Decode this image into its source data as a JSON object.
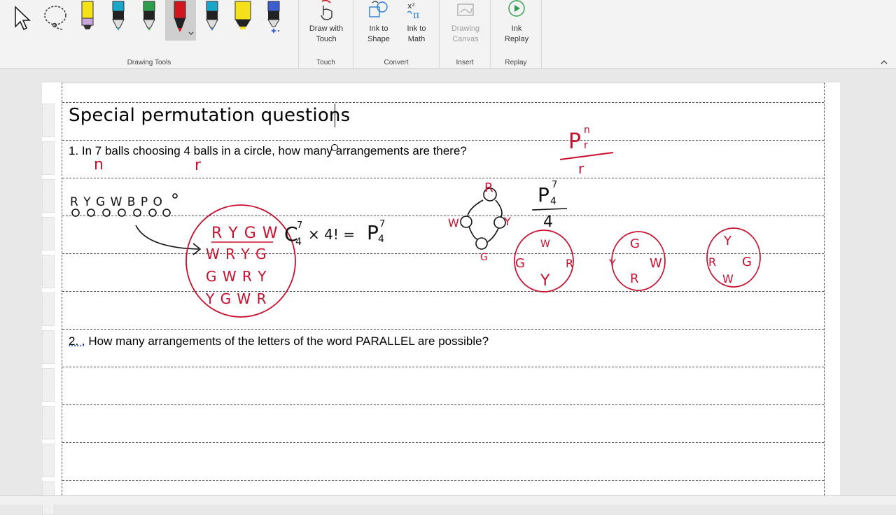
{
  "ribbon": {
    "groups": {
      "drawing_tools": "Drawing Tools",
      "touch": "Touch",
      "convert": "Convert",
      "insert": "Insert",
      "replay": "Replay"
    },
    "buttons": {
      "draw_with_touch": "Draw with\nTouch",
      "ink_to_shape": "Ink to\nShape",
      "ink_to_math": "Ink to\nMath",
      "drawing_canvas": "Drawing\nCanvas",
      "ink_replay": "Ink\nReplay"
    },
    "colors": {
      "accent": "#2b7fd6",
      "pen_yellow_hl": "#f5e11a",
      "pen_black": "#1b1b1b",
      "pen_green": "#2e9e4a",
      "pen_red": "#d2161f",
      "pen_teal": "#19a6c9",
      "pen_blue": "#3a5fcd",
      "ink_red": "#c8102e",
      "ink_black": "#111111"
    }
  },
  "document": {
    "title": "Special permutation questions",
    "q1": "1. In 7 balls choosing 4 balls in a circle, how many arrangements are there?",
    "q2_num": "2. .",
    "q2_text": " How many arrangements of the letters of the word PARALLEL are possible?"
  },
  "ink": {
    "n": "n",
    "r": "r",
    "balls_letters": "R Y G W B P O",
    "list_row1": "R Y G W",
    "list_row2": "W R Y G",
    "list_row3": "G W R Y",
    "list_row4": "Y G W R",
    "formula_c": "C",
    "formula_c_sup": "7",
    "formula_c_sub": "4",
    "formula_times": "× 4! =",
    "formula_p": "P",
    "formula_p_sup": "7",
    "formula_p_sub": "4",
    "frac_p": "P",
    "frac_p_sup": "7",
    "frac_p_sub": "4",
    "frac_den": "4",
    "prn_p": "P",
    "prn_sup": "n",
    "prn_sub": "r",
    "prn_den": "r",
    "ring_r": "R",
    "ring_w": "W",
    "ring_y": "Y",
    "ring_g": "G",
    "c1_top": "W",
    "c1_left": "G",
    "c1_right": "R",
    "c1_bottom": "Y",
    "c2_top": "G",
    "c2_left": "Y",
    "c2_right": "W",
    "c2_bottom": "R",
    "c3_top": "Y",
    "c3_left": "R",
    "c3_right": "G",
    "c3_bottom": "W"
  }
}
